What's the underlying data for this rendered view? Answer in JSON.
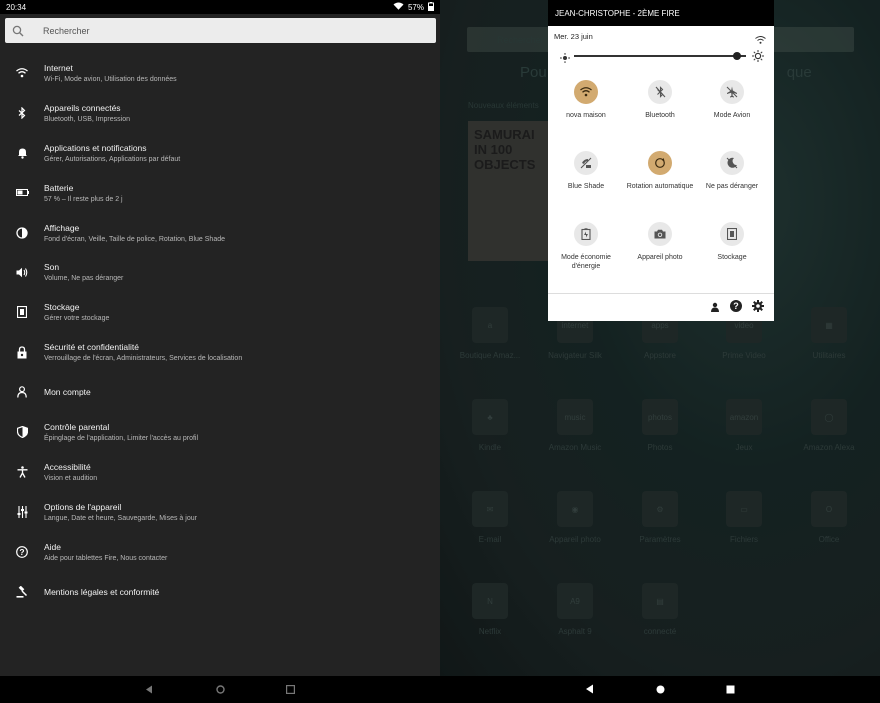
{
  "status": {
    "time": "20:34",
    "battery": "57%"
  },
  "search": {
    "placeholder": "Rechercher"
  },
  "settings": [
    {
      "title": "Internet",
      "subtitle": "Wi-Fi, Mode avion, Utilisation des données",
      "icon": "wifi-icon"
    },
    {
      "title": "Appareils connectés",
      "subtitle": "Bluetooth, USB, Impression",
      "icon": "bluetooth-icon"
    },
    {
      "title": "Applications et notifications",
      "subtitle": "Gérer, Autorisations, Applications par défaut",
      "icon": "bell-icon"
    },
    {
      "title": "Batterie",
      "subtitle": "57 % – Il reste plus de 2 j",
      "icon": "battery-icon"
    },
    {
      "title": "Affichage",
      "subtitle": "Fond d'écran, Veille, Taille de police, Rotation, Blue Shade",
      "icon": "display-icon"
    },
    {
      "title": "Son",
      "subtitle": "Volume, Ne pas déranger",
      "icon": "speaker-icon"
    },
    {
      "title": "Stockage",
      "subtitle": "Gérer votre stockage",
      "icon": "storage-icon"
    },
    {
      "title": "Sécurité et confidentialité",
      "subtitle": "Verrouillage de l'écran, Administrateurs, Services de localisation",
      "icon": "lock-icon"
    },
    {
      "title": "Mon compte",
      "subtitle": "",
      "icon": "person-icon"
    },
    {
      "title": "Contrôle parental",
      "subtitle": "Épinglage de l'application, Limiter l'accès au profil",
      "icon": "shield-icon"
    },
    {
      "title": "Accessibilité",
      "subtitle": "Vision et audition",
      "icon": "accessibility-icon"
    },
    {
      "title": "Options de l'appareil",
      "subtitle": "Langue, Date et heure, Sauvegarde, Mises à jour",
      "icon": "sliders-icon"
    },
    {
      "title": "Aide",
      "subtitle": "Aide pour tablettes Fire, Nous contacter",
      "icon": "help-icon"
    },
    {
      "title": "Mentions légales et conformité",
      "subtitle": "",
      "icon": "gavel-icon"
    }
  ],
  "home": {
    "search_placeholder": "Rechercher",
    "title_fragment": "Pou",
    "title_fragment_end": "que",
    "new_items": "Nouveaux éléments",
    "book_title": "SAMURAI IN 100 OBJECTS",
    "apps": [
      {
        "label": "Boutique Amaz...",
        "icon": "amazon-store-icon",
        "glyph": "a"
      },
      {
        "label": "Navigateur Silk",
        "icon": "silk-browser-icon",
        "glyph": "internet"
      },
      {
        "label": "Appstore",
        "icon": "appstore-icon",
        "glyph": "apps"
      },
      {
        "label": "Prime Video",
        "icon": "prime-video-icon",
        "glyph": "video"
      },
      {
        "label": "Utilitaires",
        "icon": "utilities-icon",
        "glyph": "▦"
      },
      {
        "label": "Kindle",
        "icon": "kindle-icon",
        "glyph": "♣"
      },
      {
        "label": "Amazon Music",
        "icon": "music-icon",
        "glyph": "music"
      },
      {
        "label": "Photos",
        "icon": "photos-icon",
        "glyph": "photos"
      },
      {
        "label": "Jeux",
        "icon": "games-icon",
        "glyph": "amazon"
      },
      {
        "label": "Amazon Alexa",
        "icon": "alexa-icon",
        "glyph": "◯"
      },
      {
        "label": "E-mail",
        "icon": "email-icon",
        "glyph": "✉"
      },
      {
        "label": "Appareil photo",
        "icon": "camera-app-icon",
        "glyph": "◉"
      },
      {
        "label": "Paramètres",
        "icon": "settings-app-icon",
        "glyph": "⚙"
      },
      {
        "label": "Fichiers",
        "icon": "files-icon",
        "glyph": "▭"
      },
      {
        "label": "Office",
        "icon": "office-icon",
        "glyph": "O"
      },
      {
        "label": "Netflix",
        "icon": "netflix-icon",
        "glyph": "N"
      },
      {
        "label": "Asphalt 9",
        "icon": "asphalt-icon",
        "glyph": "A9"
      },
      {
        "label": "connecté",
        "icon": "connected-icon",
        "glyph": "▤"
      }
    ]
  },
  "quick_settings": {
    "header": "JEAN-CHRISTOPHE - 2ÈME FIRE",
    "date": "Mer. 23 juin",
    "brightness": 0.95,
    "tiles": [
      {
        "label": "nova maison",
        "icon": "wifi-icon",
        "active": true
      },
      {
        "label": "Bluetooth",
        "icon": "bluetooth-off-icon",
        "active": false
      },
      {
        "label": "Mode Avion",
        "icon": "airplane-off-icon",
        "active": false
      },
      {
        "label": "Blue Shade",
        "icon": "blue-shade-icon",
        "active": false
      },
      {
        "label": "Rotation automatique",
        "icon": "auto-rotate-icon",
        "active": true
      },
      {
        "label": "Ne pas déranger",
        "icon": "do-not-disturb-icon",
        "active": false
      },
      {
        "label": "Mode économie d'énergie",
        "icon": "power-saver-icon",
        "active": false
      },
      {
        "label": "Appareil photo",
        "icon": "camera-icon",
        "active": false
      },
      {
        "label": "Stockage",
        "icon": "storage-icon",
        "active": false
      }
    ]
  }
}
